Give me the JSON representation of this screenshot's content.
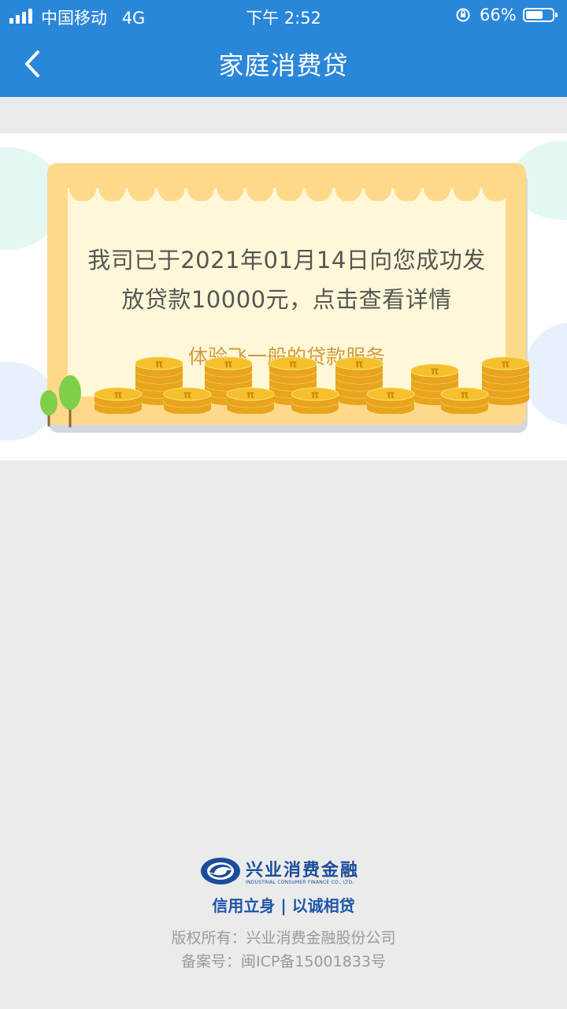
{
  "status_bar": {
    "carrier": "中国移动",
    "network": "4G",
    "time": "下午 2:52",
    "battery_percent": "66%",
    "battery_level": 0.66
  },
  "nav": {
    "title": "家庭消费贷",
    "back_icon": "chevron-left-icon"
  },
  "banner": {
    "line1": "我司已于2021年01月14日向您成功发",
    "line2": "放贷款10000元，点击查看详情",
    "tagline": "体验飞一般的贷款服务",
    "coin_symbol": "π",
    "colors": {
      "card_border": "#ffd98a",
      "card_fill": "#fff8d8",
      "tagline": "#d39a3e",
      "coin": "#f5c02c"
    }
  },
  "footer": {
    "logo_cn": "兴业消费金融",
    "logo_en": "INDUSTRIAL CONSUMER FINANCE CO., LTD.",
    "slogan": "信用立身 | 以诚相贷",
    "copyright": "版权所有：兴业消费金融股份公司",
    "icp": "备案号：闽ICP备15001833号"
  },
  "colors": {
    "brand_blue": "#2a86d9",
    "page_bg": "#ebebeb",
    "footer_text": "#9a9a9a",
    "slogan": "#1d56a8"
  }
}
